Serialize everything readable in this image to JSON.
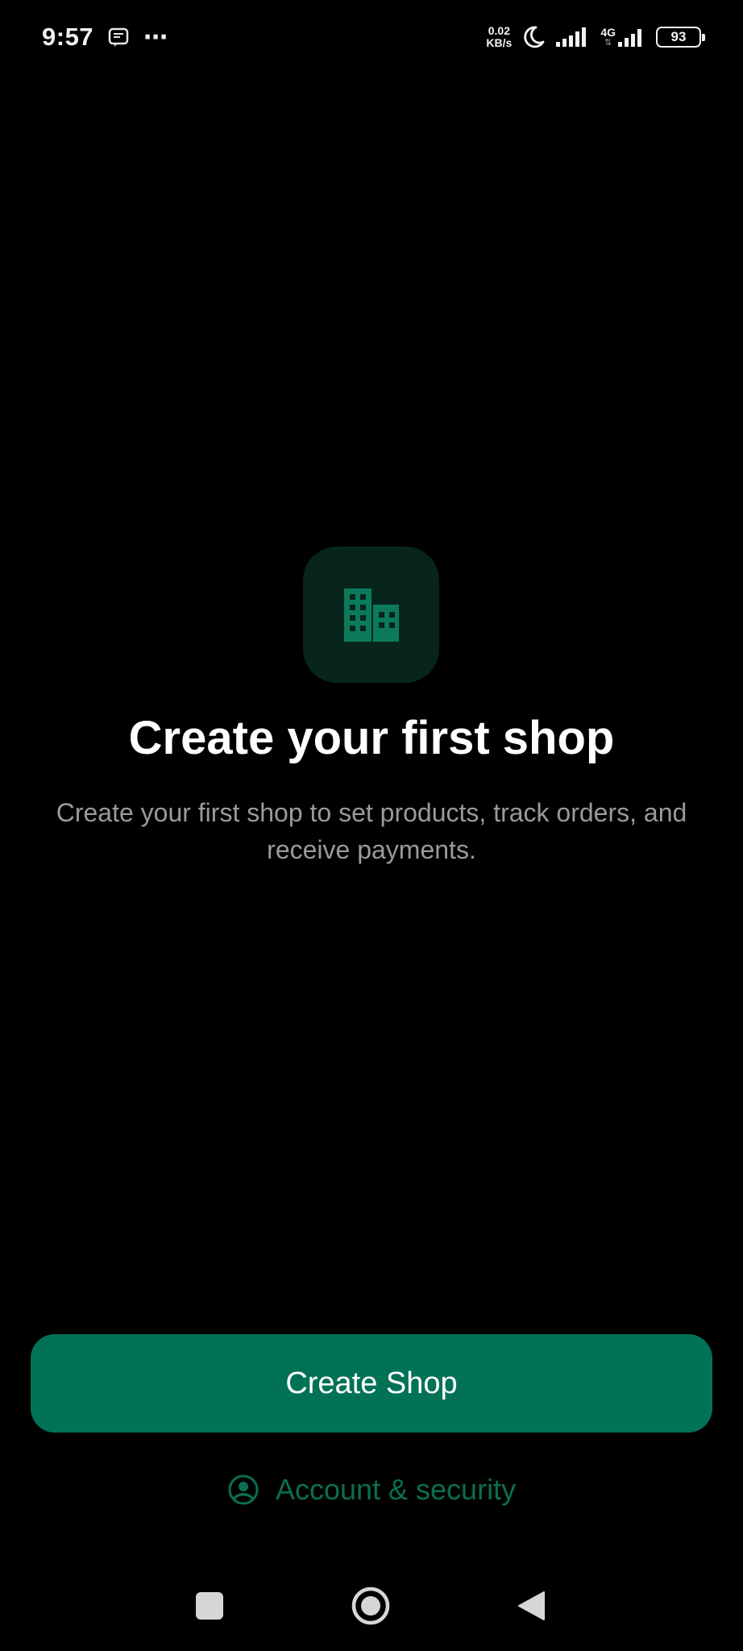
{
  "status_bar": {
    "time": "9:57",
    "more": "⋯",
    "net_speed_value": "0.02",
    "net_speed_unit": "KB/s",
    "network_type": "4G",
    "battery": "93"
  },
  "main": {
    "icon": "building-icon",
    "title": "Create your first shop",
    "subtitle": "Create your first shop to set products, track orders, and receive payments."
  },
  "actions": {
    "create_shop_label": "Create Shop",
    "account_security_label": "Account & security",
    "account_icon": "account-circle-icon"
  },
  "nav_bar": {
    "items": [
      "recents-button",
      "home-button",
      "back-button"
    ]
  },
  "colors": {
    "background": "#000000",
    "accent": "#027257",
    "accent_text": "#0b6e52",
    "icon_box": "#08251b"
  }
}
